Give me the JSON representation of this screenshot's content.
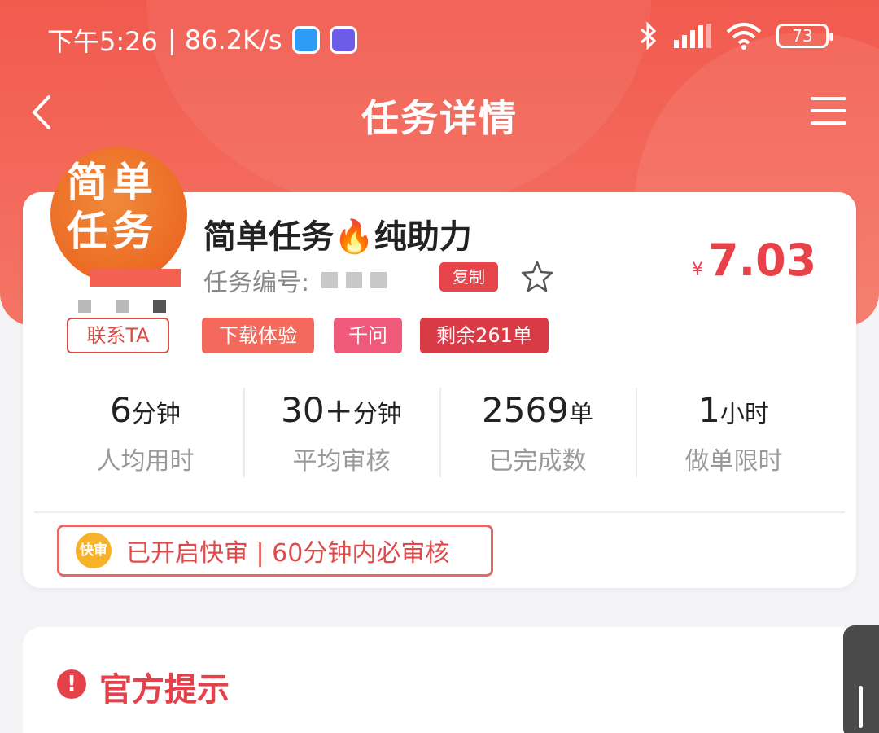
{
  "status_bar": {
    "time": "下午5:26",
    "net_speed": "| 86.2K/s",
    "battery": "73"
  },
  "nav": {
    "title": "任务详情"
  },
  "task": {
    "logo_text": "简单任务",
    "title": "简单任务🔥纯助力",
    "task_no_label": "任务编号:",
    "copy_label": "复制",
    "price_currency": "¥",
    "price": "7.03",
    "contact_label": "联系TA",
    "tags": [
      "下载体验",
      "千问",
      "剩余261单"
    ],
    "stats": [
      {
        "value": "6",
        "unit": "分钟",
        "label": "人均用时"
      },
      {
        "value": "30+",
        "unit": "分钟",
        "label": "平均审核"
      },
      {
        "value": "2569",
        "unit": "单",
        "label": "已完成数"
      },
      {
        "value": "1",
        "unit": "小时",
        "label": "做单限时"
      }
    ],
    "fast_review_badge": "快审",
    "fast_review_text": "已开启快审 | 60分钟内必审核"
  },
  "notice": {
    "icon_text": "!",
    "title": "官方提示"
  },
  "colors": {
    "header_red": "#f25a4e",
    "price_red": "#e8414a",
    "tag_orange": "#f36a5c",
    "tag_pink": "#ef5a7a",
    "tag_dark_red": "#d83b45"
  }
}
